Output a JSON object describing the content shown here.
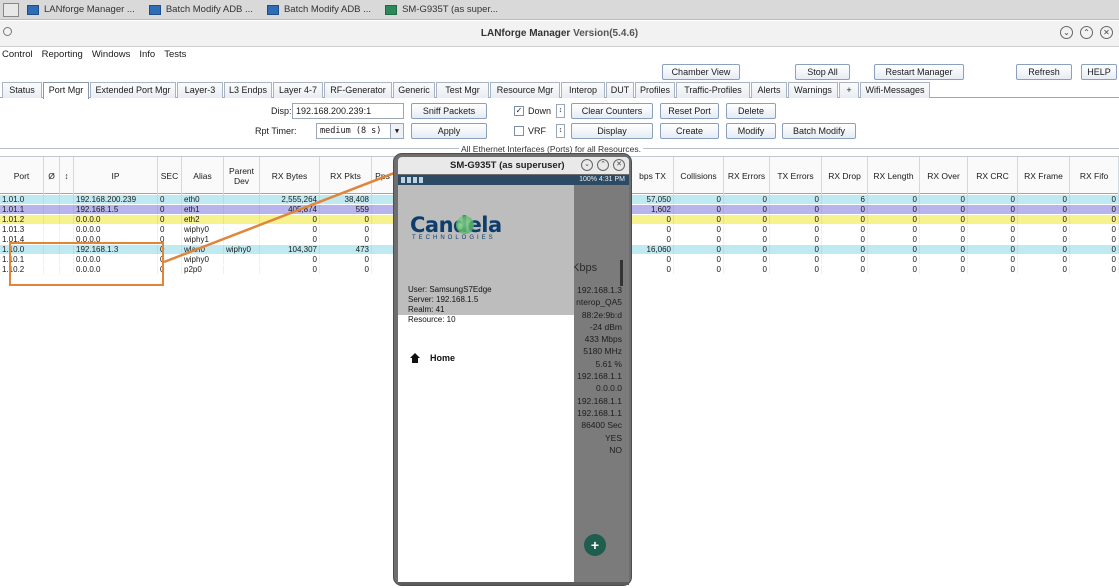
{
  "taskbar": {
    "items": [
      {
        "label": "LANforge Manager ..."
      },
      {
        "label": "Batch Modify ADB ..."
      },
      {
        "label": "Batch Modify ADB ..."
      },
      {
        "label": "SM-G935T (as super..."
      }
    ]
  },
  "window": {
    "title": "LANforge Manager",
    "version": "Version(5.4.6)"
  },
  "menu": [
    "Control",
    "Reporting",
    "Windows",
    "Info",
    "Tests"
  ],
  "toolbar": {
    "chamber_view": "Chamber View",
    "stop_all": "Stop All",
    "restart_manager": "Restart Manager",
    "refresh": "Refresh",
    "help": "HELP"
  },
  "tabs": [
    "Status",
    "Port Mgr",
    "Extended Port Mgr",
    "Layer-3",
    "L3 Endps",
    "Layer 4-7",
    "RF-Generator",
    "Generic",
    "Test Mgr",
    "Resource Mgr",
    "Interop",
    "DUT",
    "Profiles",
    "Traffic-Profiles",
    "Alerts",
    "Warnings",
    "+",
    "Wifi-Messages"
  ],
  "active_tab": "Port Mgr",
  "controls": {
    "disp_label": "Disp:",
    "disp_value": "192.168.200.239:1",
    "rpt_label": "Rpt Timer:",
    "rpt_value": "medium  (8 s)",
    "sniff": "Sniff Packets",
    "apply": "Apply",
    "down_label": "Down",
    "down_checked": true,
    "vrf_label": "VRF",
    "vrf_checked": false,
    "clear_counters": "Clear Counters",
    "display": "Display",
    "reset_port": "Reset Port",
    "create": "Create",
    "delete": "Delete",
    "modify": "Modify",
    "batch_modify": "Batch Modify"
  },
  "table": {
    "caption": "All Ethernet Interfaces (Ports) for all Resources.",
    "headers": {
      "port": "Port",
      "phantom": "Ø",
      "down": "↕",
      "ip": "IP",
      "sec": "SEC",
      "alias": "Alias",
      "parent": "Parent Dev",
      "rx_bytes": "RX Bytes",
      "rx_pkts": "RX Pkts",
      "pps": "Pps",
      "bps_tx": "bps TX",
      "collisions": "Collisions",
      "rx_errors": "RX Errors",
      "tx_errors": "TX Errors",
      "rx_drop": "RX Drop",
      "rx_length": "RX Length",
      "rx_over": "RX Over",
      "rx_crc": "RX CRC",
      "rx_frame": "RX Frame",
      "rx_fifo": "RX Fifo"
    },
    "rows": [
      {
        "port": "1.01.0",
        "ip": "192.168.200.239",
        "sec": "0",
        "alias": "eth0",
        "parent": "",
        "rx_bytes": "2,555,264",
        "rx_pkts": "38,408",
        "bps_tx": "57,050",
        "collisions": "0",
        "rx_errors": "0",
        "tx_errors": "0",
        "rx_drop": "6",
        "rx_length": "0",
        "rx_over": "0",
        "rx_crc": "0",
        "rx_frame": "0",
        "rx_fifo": "0",
        "color": "#bfeaf2"
      },
      {
        "port": "1.01.1",
        "ip": "192.168.1.5",
        "sec": "0",
        "alias": "eth1",
        "parent": "",
        "rx_bytes": "405,874",
        "rx_pkts": "559",
        "bps_tx": "1,602",
        "collisions": "0",
        "rx_errors": "0",
        "tx_errors": "0",
        "rx_drop": "0",
        "rx_length": "0",
        "rx_over": "0",
        "rx_crc": "0",
        "rx_frame": "0",
        "rx_fifo": "0",
        "color": "#b8b5ec"
      },
      {
        "port": "1.01.2",
        "ip": "0.0.0.0",
        "sec": "0",
        "alias": "eth2",
        "parent": "",
        "rx_bytes": "0",
        "rx_pkts": "0",
        "bps_tx": "0",
        "collisions": "0",
        "rx_errors": "0",
        "tx_errors": "0",
        "rx_drop": "0",
        "rx_length": "0",
        "rx_over": "0",
        "rx_crc": "0",
        "rx_frame": "0",
        "rx_fifo": "0",
        "color": "#f6f38e"
      },
      {
        "port": "1.01.3",
        "ip": "0.0.0.0",
        "sec": "0",
        "alias": "wiphy0",
        "parent": "",
        "rx_bytes": "0",
        "rx_pkts": "0",
        "bps_tx": "0",
        "collisions": "0",
        "rx_errors": "0",
        "tx_errors": "0",
        "rx_drop": "0",
        "rx_length": "0",
        "rx_over": "0",
        "rx_crc": "0",
        "rx_frame": "0",
        "rx_fifo": "0",
        "color": "#ffffff"
      },
      {
        "port": "1.01.4",
        "ip": "0.0.0.0",
        "sec": "0",
        "alias": "wiphy1",
        "parent": "",
        "rx_bytes": "0",
        "rx_pkts": "0",
        "bps_tx": "0",
        "collisions": "0",
        "rx_errors": "0",
        "tx_errors": "0",
        "rx_drop": "0",
        "rx_length": "0",
        "rx_over": "0",
        "rx_crc": "0",
        "rx_frame": "0",
        "rx_fifo": "0",
        "color": "#ffffff"
      },
      {
        "port": "1.10.0",
        "ip": "192.168.1.3",
        "sec": "0",
        "alias": "wlan0",
        "parent": "wiphy0",
        "rx_bytes": "104,307",
        "rx_pkts": "473",
        "bps_tx": "16,060",
        "collisions": "0",
        "rx_errors": "0",
        "tx_errors": "0",
        "rx_drop": "0",
        "rx_length": "0",
        "rx_over": "0",
        "rx_crc": "0",
        "rx_frame": "0",
        "rx_fifo": "0",
        "color": "#bfeaf2"
      },
      {
        "port": "1.10.1",
        "ip": "0.0.0.0",
        "sec": "0",
        "alias": "wiphy0",
        "parent": "",
        "rx_bytes": "0",
        "rx_pkts": "0",
        "bps_tx": "0",
        "collisions": "0",
        "rx_errors": "0",
        "tx_errors": "0",
        "rx_drop": "0",
        "rx_length": "0",
        "rx_over": "0",
        "rx_crc": "0",
        "rx_frame": "0",
        "rx_fifo": "0",
        "color": "#ffffff"
      },
      {
        "port": "1.10.2",
        "ip": "0.0.0.0",
        "sec": "0",
        "alias": "p2p0",
        "parent": "",
        "rx_bytes": "0",
        "rx_pkts": "0",
        "bps_tx": "0",
        "collisions": "0",
        "rx_errors": "0",
        "tx_errors": "0",
        "rx_drop": "0",
        "rx_length": "0",
        "rx_over": "0",
        "rx_crc": "0",
        "rx_frame": "0",
        "rx_fifo": "0",
        "color": "#ffffff"
      }
    ]
  },
  "phone": {
    "title": "SM-G935T (as superuser)",
    "status_time": "100% 4:31 PM",
    "logo": "Candela",
    "logo_sub": "TECHNOLOGIES",
    "user": "User: SamsungS7Edge",
    "server": "Server: 192.168.1.5",
    "realm": "Realm: 41",
    "resource": "Resource: 10",
    "home": "Home",
    "kbps": "Kbps",
    "stats": [
      "192.168.1.3",
      "nterop_QA5",
      "88:2e:9b:d",
      "-24 dBm",
      "433 Mbps",
      "5180 MHz",
      "5.61 %",
      "192.168.1.1",
      "0.0.0.0",
      "192.168.1.1",
      "192.168.1.1",
      "86400 Sec",
      "YES",
      "NO"
    ],
    "fab": "+"
  }
}
